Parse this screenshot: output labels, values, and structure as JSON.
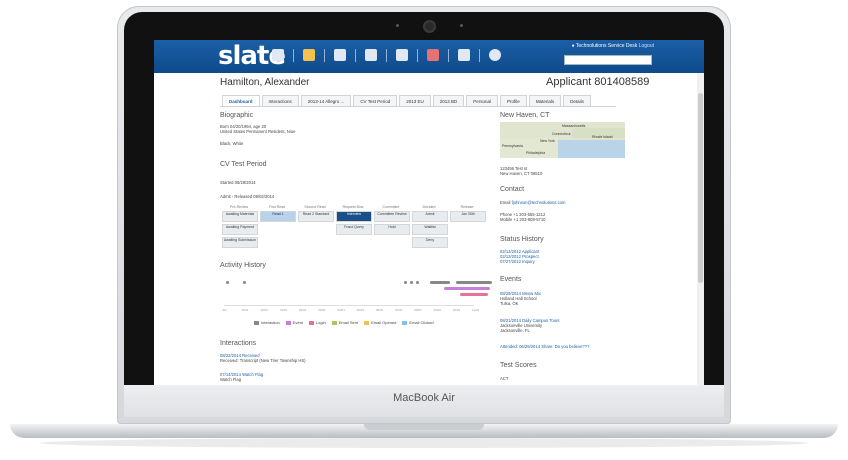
{
  "device": {
    "brand": "MacBook Air"
  },
  "app": {
    "logo": "slate",
    "helpdesk": "Technolutions Service Desk",
    "logout": "Logout",
    "nav_icons": [
      "folder-icon",
      "star-icon",
      "calendar-icon",
      "mail-icon",
      "document-icon",
      "image-icon",
      "users-icon",
      "gear-icon"
    ]
  },
  "header": {
    "name": "Hamilton, Alexander",
    "applicant": "Applicant   801408589"
  },
  "tabs": [
    "Dashboard",
    "Interactions",
    "2013-14 Allegro ...",
    "CV Test Period",
    "2013 EU",
    "2013 BD",
    "Personal",
    "Profile",
    "Materials",
    "Details"
  ],
  "biographic": {
    "title": "Biographic",
    "lines": [
      "Born 04/20/1994, age 20",
      "United States Permanent Resident, Niue",
      "",
      "Black, White"
    ]
  },
  "period": {
    "title": "CV Test Period",
    "started": "Started 08/29/2014",
    "admit": "Admit - Released 09/02/2014"
  },
  "stages": {
    "headers": [
      "Pre-Review",
      "First Read",
      "Second Read",
      "Request Bins",
      "Committee",
      "Decided",
      "Release"
    ],
    "cells": [
      [
        "Awaiting Materials",
        "Awaiting Payment",
        "Awaiting Submission"
      ],
      [
        "Read 1"
      ],
      [
        "Read 2 Standard"
      ],
      [
        "Interview",
        "Fraud Query"
      ],
      [
        "Committee Review",
        "Hold"
      ],
      [
        "Admit",
        "Waitlist",
        "Deny"
      ],
      [
        "Jan 30th"
      ]
    ]
  },
  "activity": {
    "title": "Activity History",
    "axis": [
      "Jan",
      "11/01",
      "12/01",
      "01/01",
      "02/01",
      "03/01",
      "04/01",
      "05/01",
      "06/01",
      "07/01",
      "08/01",
      "09/01",
      "10/01",
      "11/01"
    ],
    "legend": [
      {
        "label": "Interaction",
        "color": "#888888"
      },
      {
        "label": "Event",
        "color": "#c77ddb"
      },
      {
        "label": "Login",
        "color": "#e57399"
      },
      {
        "label": "Email Sent",
        "color": "#a9c95a"
      },
      {
        "label": "Email Opened",
        "color": "#f2c14e"
      },
      {
        "label": "Email Clicked",
        "color": "#8fbbe8"
      }
    ]
  },
  "interactions": {
    "title": "Interactions",
    "items": [
      {
        "date": "08/22/2014 Received",
        "text": "Received: Transcript (New Trier Township HS)"
      },
      {
        "date": "07/14/2014 Watch Flag",
        "text": "Watch Flag"
      }
    ]
  },
  "location": {
    "title": "New Haven, CT",
    "map_labels": [
      "Massachusetts",
      "Connecticut",
      "Rhode Island",
      "New York",
      "Pennsylvania",
      "Philadelphia"
    ],
    "address": [
      "123456 Test st",
      "New Haven, CT 06510"
    ]
  },
  "contact": {
    "title": "Contact",
    "email_label": "Email",
    "email": "fjohnson@technolutions.com",
    "phone": "Phone +1 203-555-1212",
    "mobile": "Mobile +1 203-808-5710"
  },
  "status_history": {
    "title": "Status History",
    "items": [
      "02/13/2012 Applicant",
      "02/13/2012 Prospect",
      "07/27/2012 Inquiry"
    ]
  },
  "events": {
    "title": "Events",
    "items": [
      {
        "date": "08/29/2014 Meow Mix",
        "lines": [
          "Holland Hall School",
          "Tulsa, OK"
        ]
      },
      {
        "date": "08/21/2014 Daily Campus Tours",
        "lines": [
          "Jacksonville University",
          "Jacksonville, FL"
        ]
      }
    ],
    "attended": "Attended: 06/29/2014 Share: Do you believe???"
  },
  "test_scores": {
    "title": "Test Scores",
    "items": [
      "ACT"
    ]
  }
}
